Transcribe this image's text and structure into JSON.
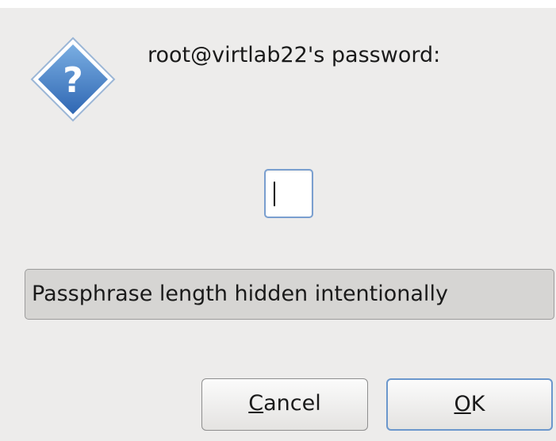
{
  "dialog": {
    "prompt": "root@virtlab22's password:",
    "password_value": "",
    "hint": "Passphrase length hidden intentionally",
    "icon": "question-icon",
    "buttons": {
      "cancel": {
        "mnemonic": "C",
        "rest": "ancel"
      },
      "ok": {
        "mnemonic": "O",
        "rest": "K"
      }
    }
  },
  "colors": {
    "dialog_background": "#edeceb",
    "icon_blue": "#3f7cc4",
    "focus_border": "#6b97cc",
    "hint_background": "#d6d5d3"
  }
}
